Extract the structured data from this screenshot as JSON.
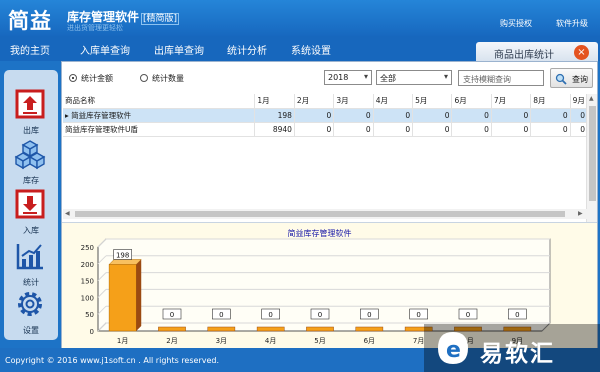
{
  "app": {
    "logo": "简益",
    "title": "库存管理软件",
    "edition": "[精简版]",
    "subtitle": "进出货管理更轻松",
    "links": [
      "购买授权",
      "软件升级"
    ]
  },
  "menu": [
    "我的主页",
    "入库单查询",
    "出库单查询",
    "统计分析",
    "系统设置"
  ],
  "panel": {
    "title": "商品出库统计",
    "close": "×"
  },
  "sidebar": [
    {
      "label": "出库",
      "icon": "export-box-icon"
    },
    {
      "label": "库存",
      "icon": "cubes-icon"
    },
    {
      "label": "入库",
      "icon": "import-box-icon"
    },
    {
      "label": "统计",
      "icon": "chart-icon"
    },
    {
      "label": "设置",
      "icon": "gear-icon"
    }
  ],
  "filters": {
    "radio_amount": "统计金额",
    "radio_qty": "统计数量",
    "year": "2018",
    "category": "全部",
    "search_placeholder": "支持模糊查询",
    "search_button": "查询"
  },
  "table": {
    "columns": [
      "商品名称",
      "1月",
      "2月",
      "3月",
      "4月",
      "5月",
      "6月",
      "7月",
      "8月",
      "9月"
    ],
    "rows": [
      {
        "marker": "▸",
        "name": "简益库存管理软件",
        "values": [
          "198",
          "0",
          "0",
          "0",
          "0",
          "0",
          "0",
          "0",
          "0"
        ]
      },
      {
        "marker": "",
        "name": "简益库存管理软件U盾",
        "values": [
          "8940",
          "0",
          "0",
          "0",
          "0",
          "0",
          "0",
          "0",
          "0"
        ]
      }
    ]
  },
  "footer": {
    "copyright": "Copyright © 2016 www.j1soft.cn . All rights reserved."
  },
  "watermark": {
    "text": "易软汇"
  },
  "chart_data": {
    "type": "bar",
    "title": "简益库存管理软件",
    "series": [
      {
        "values": [
          198,
          0,
          0,
          0,
          0,
          0,
          0,
          0,
          0
        ]
      }
    ],
    "categories": [
      "1月",
      "2月",
      "3月",
      "4月",
      "5月",
      "6月",
      "7月",
      "8月",
      "9月"
    ],
    "yticks": [
      0,
      50,
      100,
      150,
      200,
      250
    ],
    "ylim": [
      0,
      250
    ],
    "data_labels": [
      "198",
      "0",
      "0",
      "0",
      "0",
      "0",
      "0",
      "0",
      "0"
    ],
    "bar_color": "#f5a019",
    "side_color": "#9b4a12",
    "grid": true
  }
}
